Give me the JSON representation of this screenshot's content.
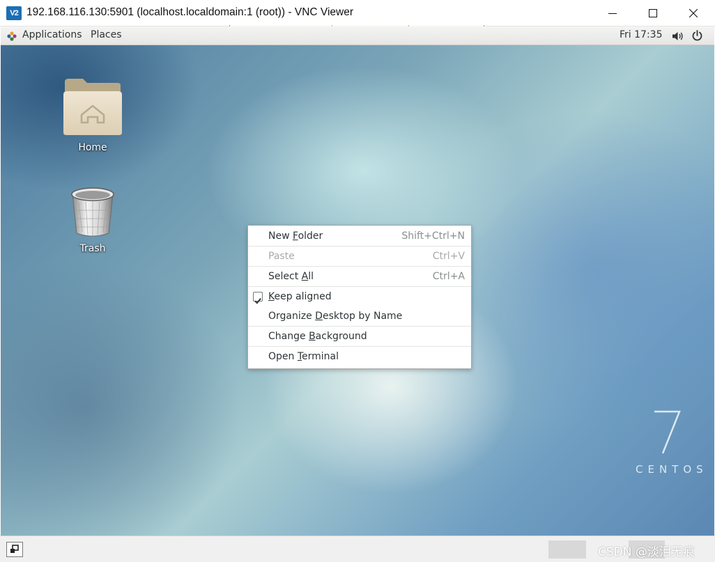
{
  "window": {
    "logo_text": "V2",
    "title": "192.168.116.130:5901 (localhost.localdomain:1 (root)) - VNC Viewer"
  },
  "panel": {
    "applications_label": "Applications",
    "places_label": "Places",
    "clock": "Fri 17:35"
  },
  "desktop": {
    "icons": [
      {
        "label": "Home"
      },
      {
        "label": "Trash"
      }
    ],
    "branding": {
      "number": "7",
      "text": "CENTOS"
    }
  },
  "context_menu": {
    "items": [
      {
        "label": "New Folder",
        "mnemonic": "F",
        "shortcut": "Shift+Ctrl+N",
        "enabled": true
      },
      {
        "label": "Paste",
        "mnemonic": "",
        "shortcut": "Ctrl+V",
        "enabled": false
      },
      {
        "label": "Select All",
        "mnemonic": "A",
        "shortcut": "Ctrl+A",
        "enabled": true
      },
      {
        "label": "Keep aligned",
        "mnemonic": "K",
        "shortcut": "",
        "enabled": true,
        "checked": true
      },
      {
        "label": "Organize Desktop by Name",
        "mnemonic": "D",
        "shortcut": "",
        "enabled": true
      },
      {
        "label": "Change Background",
        "mnemonic": "B",
        "shortcut": "",
        "enabled": true
      },
      {
        "label": "Open Terminal",
        "mnemonic": "T",
        "shortcut": "",
        "enabled": true
      }
    ]
  },
  "watermark": "CSDN @淡泪无痕",
  "colors": {
    "vnc_logo": "#1c6fb3",
    "menu_text": "#2e3436",
    "menu_disabled": "#a6aaab"
  }
}
